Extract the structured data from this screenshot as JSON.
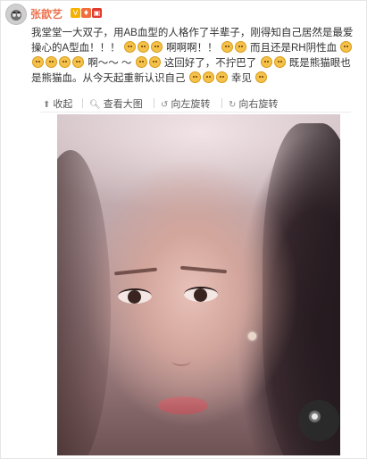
{
  "post": {
    "username": "张歆艺",
    "badges": {
      "verified": "V"
    },
    "text_segments": [
      "我堂堂一大双子，用AB血型的人格作了半辈子，刚得知自己居然是最爱操心的A型血！！！",
      "啊啊啊！！",
      "而且还是RH阴性血",
      "啊～～",
      "～",
      "这回好了，不拧巴了",
      "既是熊猫眼也是熊猫血。从今天起重新认识自己",
      "幸见"
    ]
  },
  "toolbar": {
    "collapse_label": "收起",
    "view_large_label": "查看大图",
    "rotate_left_label": "向左旋转",
    "rotate_right_label": "向右旋转",
    "icons": [
      "collapse-arrow-icon",
      "magnifier-icon",
      "rotate-left-icon",
      "rotate-right-icon"
    ]
  },
  "colors": {
    "username": "#eb7350",
    "text": "#333333",
    "toolbar_text": "#555555"
  }
}
